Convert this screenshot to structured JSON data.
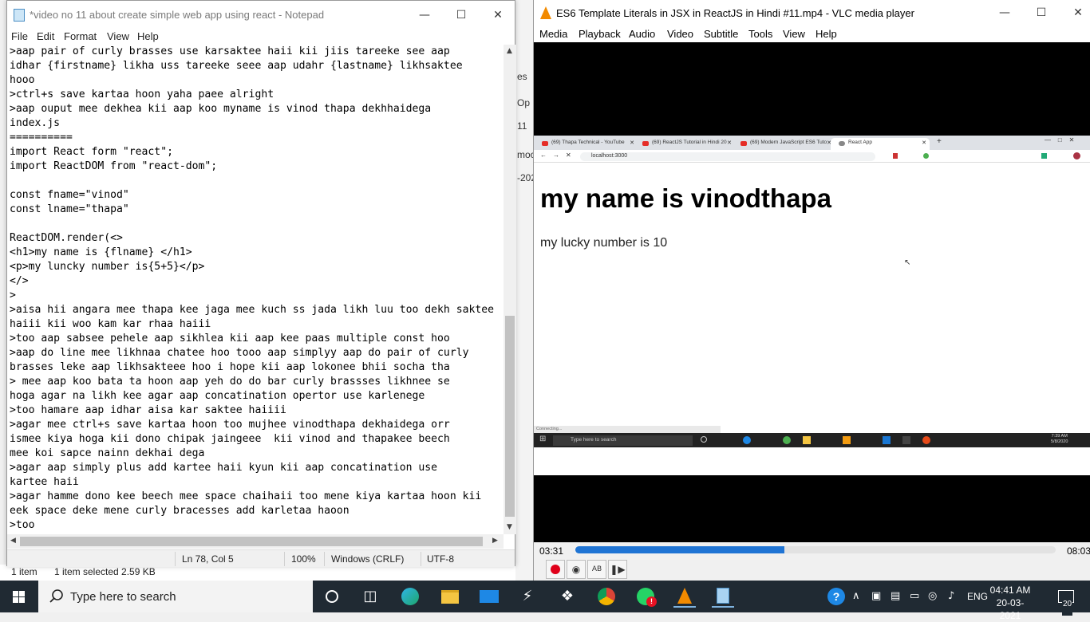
{
  "explorer": {
    "side_fragments": [
      "es",
      "Op",
      "11",
      "moc",
      "-202"
    ],
    "status_items": "1 item",
    "status_selected": "1 item selected  2.59 KB"
  },
  "notepad": {
    "title": "*video no 11 about create simple web app using react - Notepad",
    "menu": [
      "File",
      "Edit",
      "Format",
      "View",
      "Help"
    ],
    "text": ">aap pair of curly brasses use karsaktee haii kii jiis tareeke see aap\nidhar {firstname} likha uss tareeke seee aap udahr {lastname} likhsaktee\nhooo\n>ctrl+s save kartaa hoon yaha paee alright\n>aap ouput mee dekhea kii aap koo myname is vinod thapa dekhhaidega\nindex.js\n==========\nimport React form \"react\";\nimport ReactDOM from \"react-dom\";\n\nconst fname=\"vinod\"\nconst lname=\"thapa\"\n\nReactDOM.render(<>\n<h1>my name is {flname} </h1>\n<p>my luncky number is{5+5}</p>\n</>\n>\n>aisa hii angara mee thapa kee jaga mee kuch ss jada likh luu too dekh saktee\nhaiii kii woo kam kar rhaa haiii\n>too aap sabsee pehele aap sikhlea kii aap kee paas multiple const hoo\n>aap do line mee likhnaa chatee hoo tooo aap simplyy aap do pair of curly\nbrasses leke aap likhsakteee hoo i hope kii aap lokonee bhii socha tha\n> mee aap koo bata ta hoon aap yeh do do bar curly brassses likhnee se\nhoga agar na likh kee agar aap concatination opertor use karlenege\n>too hamare aap idhar aisa kar saktee haiiii\n>agar mee ctrl+s save kartaa hoon too mujhee vinodthapa dekhaidega orr\nismee kiya hoga kii dono chipak jaingeee  kii vinod and thapakee beech\nmee koi sapce nainn dekhai dega\n>agar aap simply plus add kartee haii kyun kii aap concatination use\nkartee haii\n>agar hamme dono kee beech mee space chaihaii too mene kiya kartaa hoon kii\neek space deke mene curly bracesses add karletaa haoon\n>too",
    "status": {
      "position": "Ln 78, Col 5",
      "zoom": "100%",
      "line_ending": "Windows (CRLF)",
      "encoding": "UTF-8"
    }
  },
  "vlc": {
    "title": "ES6 Template Literals in JSX in ReactJS in Hindi #11.mp4 - VLC media player",
    "menu": [
      "Media",
      "Playback",
      "Audio",
      "Video",
      "Subtitle",
      "Tools",
      "View",
      "Help"
    ],
    "time_elapsed": "03:31",
    "time_total": "08:03",
    "progress": 0.435,
    "browser": {
      "tabs": [
        "(69) Thapa Technical - YouTube",
        "(69) ReactJS Tutorial in Hindi 20",
        "(69) Modern JavaScript ES6 Tuto",
        "React App"
      ],
      "url": "localhost:3000",
      "heading": "my name is vinodthapa",
      "paragraph": "my lucky number is 10",
      "status": "Connecting...",
      "taskbar_search": "Type here to search",
      "clock_time": "7:39 AM",
      "clock_date": "5/8/2020"
    }
  },
  "taskbar": {
    "search_placeholder": "Type here to search",
    "lang": "ENG",
    "time": "04:41 AM",
    "date": "20-03-2021",
    "notifications": "20",
    "whatsapp_badge": "!"
  },
  "colors": {
    "taskbar_bg": "#202a33",
    "vlc_seek": "#1f74d4",
    "record_red": "#e0001a"
  }
}
